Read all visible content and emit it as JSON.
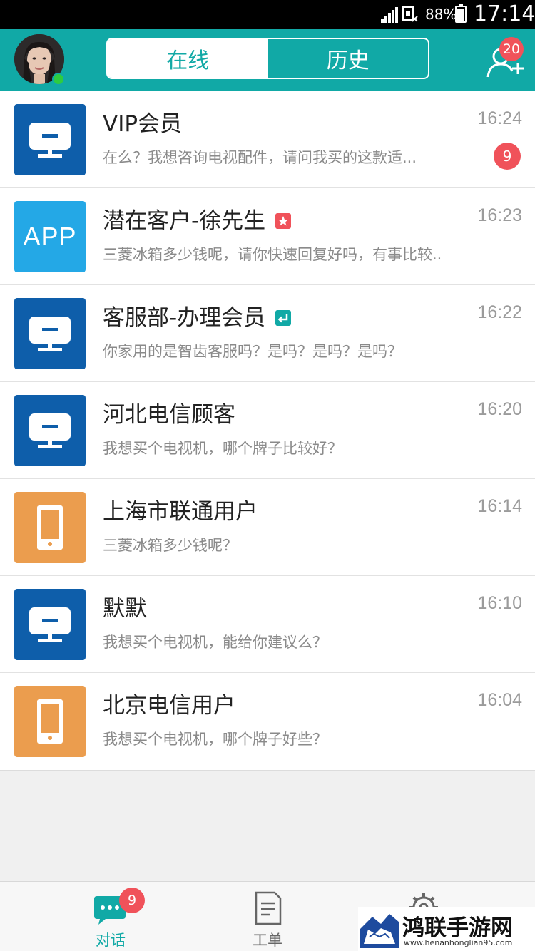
{
  "status_bar": {
    "battery": "88%",
    "time": "17:14"
  },
  "header": {
    "tabs": [
      {
        "label": "在线",
        "active": true
      },
      {
        "label": "历史",
        "active": false
      }
    ],
    "add_user_badge": "20",
    "online_status_color": "#2ecc40"
  },
  "colors": {
    "primary": "#11a9a6",
    "badge": "#f0525a",
    "icon_blue": "#0e5eaa",
    "icon_sky": "#24a8e6",
    "icon_orange": "#eb9d4e"
  },
  "conversations": [
    {
      "title": "VIP会员",
      "time": "16:24",
      "preview": "在么？我想咨询电视配件，请问我买的这款适...",
      "badge": "9",
      "icon": "monitor-icon"
    },
    {
      "title": "潜在客户-徐先生",
      "time": "16:23",
      "preview": "三菱冰箱多少钱呢，请你快速回复好吗，有事比较..",
      "tag": "star-tag-icon",
      "icon": "app-icon",
      "icon_text": "APP"
    },
    {
      "title": "客服部-办理会员",
      "time": "16:22",
      "preview": "你家用的是智齿客服吗？是吗？是吗？是吗？",
      "tag": "enter-tag-icon",
      "icon": "monitor-icon"
    },
    {
      "title": "河北电信顾客",
      "time": "16:20",
      "preview": "我想买个电视机，哪个牌子比较好？",
      "icon": "monitor-icon"
    },
    {
      "title": "上海市联通用户",
      "time": "16:14",
      "preview": "三菱冰箱多少钱呢？",
      "icon": "mobile-icon"
    },
    {
      "title": "默默",
      "time": "16:10",
      "preview": "我想买个电视机，能给你建议么？",
      "icon": "monitor-icon"
    },
    {
      "title": "北京电信用户",
      "time": "16:04",
      "preview": "我想买个电视机，哪个牌子好些？",
      "icon": "mobile-icon"
    }
  ],
  "bottom_nav": {
    "items": [
      {
        "label": "对话",
        "badge": "9",
        "icon": "chat-icon",
        "active": true
      },
      {
        "label": "工单",
        "icon": "document-icon",
        "active": false
      },
      {
        "label": "",
        "icon": "gear-icon",
        "active": false
      }
    ]
  },
  "watermark": {
    "title": "鸿联手游网",
    "url": "www.henanhonglian95.com"
  }
}
